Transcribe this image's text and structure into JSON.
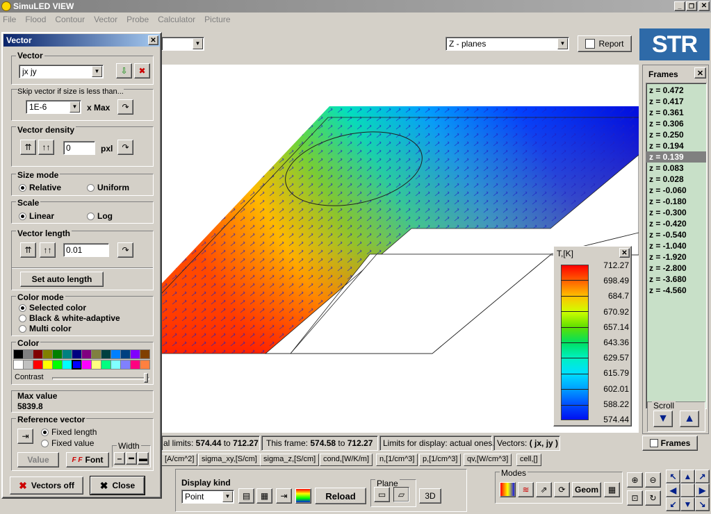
{
  "app": {
    "title": "SimuLED VIEW"
  },
  "menu": [
    "File",
    "Flood",
    "Contour",
    "Vector",
    "Probe",
    "Calculator",
    "Picture"
  ],
  "toolbar": {
    "plane_select": "Z - planes",
    "report_label": "Report",
    "logo_text": "STR"
  },
  "vector_panel": {
    "title": "Vector",
    "vector_label": "Vector",
    "vector_value": "jx jy",
    "skip_label": "Skip vector if size is less than...",
    "skip_value": "1E-6",
    "xmax_label": "x Max",
    "density_label": "Vector density",
    "density_value": "0",
    "pxl_label": "pxl",
    "size_mode_label": "Size mode",
    "size_relative": "Relative",
    "size_uniform": "Uniform",
    "scale_label": "Scale",
    "scale_linear": "Linear",
    "scale_log": "Log",
    "length_label": "Vector length",
    "length_value": "0.01",
    "auto_length_label": "Set auto length",
    "color_mode_label": "Color mode",
    "color_selected": "Selected color",
    "color_bw": "Black & white-adaptive",
    "color_multi": "Multi color",
    "color_label": "Color",
    "contrast_label": "Contrast",
    "max_label": "Max value",
    "max_value": "5839.8",
    "ref_label": "Reference vector",
    "ref_fixed_length": "Fixed length",
    "ref_fixed_value": "Fixed value",
    "width_label": "Width",
    "value_btn": "Value",
    "font_btn": "Font",
    "vectors_off": "Vectors off",
    "close": "Close",
    "palette": [
      "#000000",
      "#808080",
      "#800000",
      "#808000",
      "#008000",
      "#008080",
      "#000080",
      "#800080",
      "#808040",
      "#004040",
      "#0080ff",
      "#004080",
      "#8000ff",
      "#804000",
      "#ffffff",
      "#c0c0c0",
      "#ff0000",
      "#ffff00",
      "#00ff00",
      "#00ffff",
      "#0000ff",
      "#ff00ff",
      "#ffff80",
      "#00ff80",
      "#80ffff",
      "#8080ff",
      "#ff0080",
      "#ff8040"
    ]
  },
  "frames": {
    "title": "Frames",
    "items": [
      "z = 0.472",
      "z = 0.417",
      "z = 0.361",
      "z = 0.306",
      "z = 0.250",
      "z = 0.194",
      "z = 0.139",
      "z = 0.083",
      "z = 0.028",
      "z = -0.060",
      "z = -0.180",
      "z = -0.300",
      "z = -0.420",
      "z = -0.540",
      "z = -1.040",
      "z = -1.920",
      "z = -2.800",
      "z = -3.680",
      "z = -4.560"
    ],
    "selected": "z = 0.139",
    "scroll_label": "Scroll",
    "tab_label": "Frames"
  },
  "legend": {
    "title": "T,[K]",
    "values": [
      "712.27",
      "698.49",
      "684.7",
      "670.92",
      "657.14",
      "643.36",
      "629.57",
      "615.79",
      "602.01",
      "588.22",
      "574.44"
    ]
  },
  "status": {
    "limits_prefix": "al limits: ",
    "limits_min": "574.44",
    "limits_to": " to ",
    "limits_max": "712.27",
    "frame_prefix": "This frame: ",
    "frame_min": "574.58",
    "frame_max": "712.27",
    "display_limits": "Limits for display: actual ones.",
    "vectors_prefix": "Vectors: ",
    "vectors_value": "( jx, jy )"
  },
  "tabs": [
    "[A/cm^2]",
    "sigma_xy,[S/cm]",
    "sigma_z,[S/cm]",
    "cond,[W/K/m]",
    "n,[1/cm^3]",
    "p,[1/cm^3]",
    "qv,[W/cm^3]",
    "cell,[]"
  ],
  "bottom": {
    "display_kind_label": "Display kind",
    "display_kind_value": "Point",
    "reload_label": "Reload",
    "plane_label": "Plane",
    "btn_3d": "3D",
    "modes_label": "Modes",
    "geom_label": "Geom"
  }
}
